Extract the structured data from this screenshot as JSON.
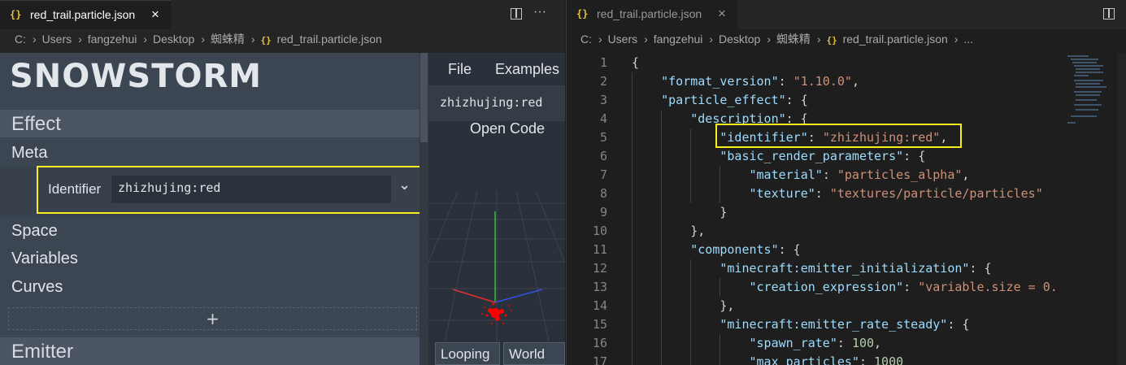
{
  "colors": {
    "highlight": "#f6ef1f",
    "json_key": "#9cdcfe",
    "json_string": "#ce9178",
    "json_number": "#b5cea8",
    "axis_x": "#e03030",
    "axis_y": "#30c030",
    "axis_z": "#3050e0",
    "particles": "#ff0000"
  },
  "left_editor": {
    "tab": {
      "icon": "json-braces-icon",
      "label": "red_trail.particle.json",
      "close": "×"
    },
    "actions": {
      "split": "split-editor-icon",
      "more": "···"
    },
    "breadcrumbs": [
      "C:",
      "Users",
      "fangzehui",
      "Desktop",
      "蜘蛛精",
      "red_trail.particle.json"
    ]
  },
  "snowstorm": {
    "logo": "SNOWSTORM",
    "sections": {
      "effect": "Effect",
      "meta": "Meta",
      "identifier_label": "Identifier",
      "identifier_value": "zhizhujing:red",
      "space": "Space",
      "variables": "Variables",
      "curves": "Curves",
      "add": "+",
      "emitter": "Emitter"
    },
    "preview": {
      "menu": [
        "File",
        "Examples"
      ],
      "title": "zhizhujing:red",
      "open_code": "Open Code",
      "buttons": [
        "Looping",
        "World"
      ]
    }
  },
  "right_editor": {
    "tab": {
      "icon": "json-braces-icon",
      "label": "red_trail.particle.json",
      "close": "×"
    },
    "breadcrumbs": [
      "C:",
      "Users",
      "fangzehui",
      "Desktop",
      "蜘蛛精",
      "red_trail.particle.json",
      "..."
    ],
    "lines": [
      {
        "n": "1",
        "parts": [
          [
            "p",
            "{"
          ]
        ]
      },
      {
        "n": "2",
        "parts": [
          [
            "p",
            "    "
          ],
          [
            "k",
            "\"format_version\""
          ],
          [
            "p",
            ": "
          ],
          [
            "s",
            "\"1.10.0\""
          ],
          [
            "p",
            ","
          ]
        ]
      },
      {
        "n": "3",
        "parts": [
          [
            "p",
            "    "
          ],
          [
            "k",
            "\"particle_effect\""
          ],
          [
            "p",
            ": {"
          ]
        ]
      },
      {
        "n": "4",
        "parts": [
          [
            "p",
            "        "
          ],
          [
            "k",
            "\"description\""
          ],
          [
            "p",
            ": {"
          ]
        ]
      },
      {
        "n": "5",
        "parts": [
          [
            "p",
            "            "
          ],
          [
            "k",
            "\"identifier\""
          ],
          [
            "p",
            ": "
          ],
          [
            "s",
            "\"zhizhujing:red\""
          ],
          [
            "p",
            ","
          ]
        ]
      },
      {
        "n": "6",
        "parts": [
          [
            "p",
            "            "
          ],
          [
            "k",
            "\"basic_render_parameters\""
          ],
          [
            "p",
            ": {"
          ]
        ]
      },
      {
        "n": "7",
        "parts": [
          [
            "p",
            "                "
          ],
          [
            "k",
            "\"material\""
          ],
          [
            "p",
            ": "
          ],
          [
            "s",
            "\"particles_alpha\""
          ],
          [
            "p",
            ","
          ]
        ]
      },
      {
        "n": "8",
        "parts": [
          [
            "p",
            "                "
          ],
          [
            "k",
            "\"texture\""
          ],
          [
            "p",
            ": "
          ],
          [
            "s",
            "\"textures/particle/particles\""
          ]
        ]
      },
      {
        "n": "9",
        "parts": [
          [
            "p",
            "            }"
          ]
        ]
      },
      {
        "n": "10",
        "parts": [
          [
            "p",
            "        },"
          ]
        ]
      },
      {
        "n": "11",
        "parts": [
          [
            "p",
            "        "
          ],
          [
            "k",
            "\"components\""
          ],
          [
            "p",
            ": {"
          ]
        ]
      },
      {
        "n": "12",
        "parts": [
          [
            "p",
            "            "
          ],
          [
            "k",
            "\"minecraft:emitter_initialization\""
          ],
          [
            "p",
            ": {"
          ]
        ]
      },
      {
        "n": "13",
        "parts": [
          [
            "p",
            "                "
          ],
          [
            "k",
            "\"creation_expression\""
          ],
          [
            "p",
            ": "
          ],
          [
            "s",
            "\"variable.size = 0."
          ]
        ]
      },
      {
        "n": "14",
        "parts": [
          [
            "p",
            "            },"
          ]
        ]
      },
      {
        "n": "15",
        "parts": [
          [
            "p",
            "            "
          ],
          [
            "k",
            "\"minecraft:emitter_rate_steady\""
          ],
          [
            "p",
            ": {"
          ]
        ]
      },
      {
        "n": "16",
        "parts": [
          [
            "p",
            "                "
          ],
          [
            "k",
            "\"spawn_rate\""
          ],
          [
            "p",
            ": "
          ],
          [
            "n",
            "100"
          ],
          [
            "p",
            ","
          ]
        ]
      },
      {
        "n": "17",
        "parts": [
          [
            "p",
            "                "
          ],
          [
            "k",
            "\"max_particles\""
          ],
          [
            "p",
            ": "
          ],
          [
            "n",
            "1000"
          ]
        ]
      }
    ]
  }
}
